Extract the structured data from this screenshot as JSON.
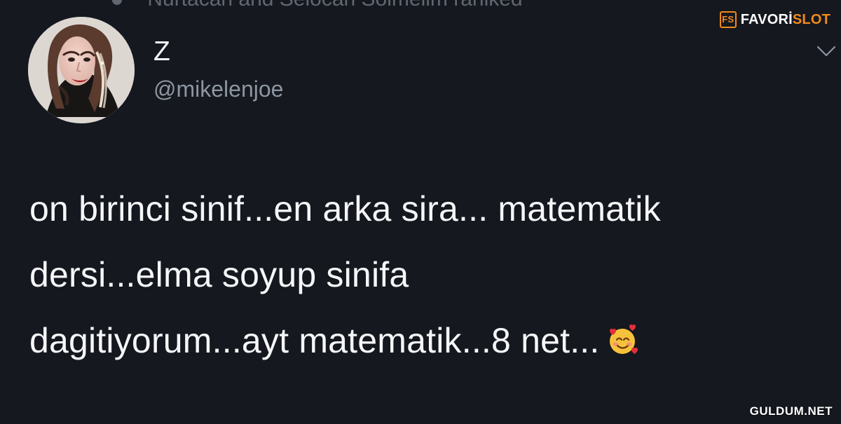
{
  "tweet": {
    "display_name": "Z",
    "handle": "@mikelenjoe",
    "top_cut_text": "Nurtacan and Selocan Solmelim rarliked",
    "lines": [
      "on birinci sinif...en arka sira... matematik",
      "dersi...elma soyup sinifa",
      "dagitiyorum...ayt matematik...8 net..."
    ],
    "emoji_name": "smiling-face-with-hearts-icon"
  },
  "overlay": {
    "brand_mark": "FS",
    "brand_name": "FAVORİ",
    "brand_accent": "SLOT",
    "watermark": "GULDUM.NET"
  },
  "colors": {
    "background": "#15181f",
    "text": "#f5f6f7",
    "muted": "#8d96a0",
    "brand_orange": "#f08a1c"
  },
  "icons": {
    "chevron": "chevron-down-icon",
    "avatar": "avatar"
  }
}
